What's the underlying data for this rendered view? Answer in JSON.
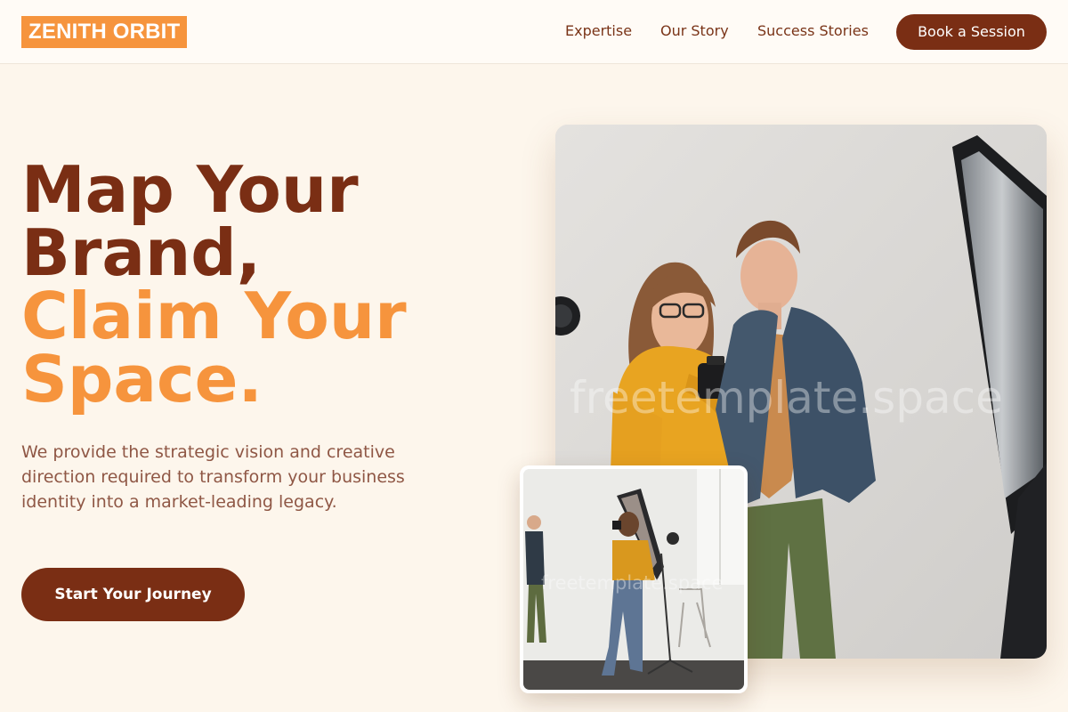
{
  "brand": {
    "logo_text": "ZENITH ORBIT"
  },
  "nav": {
    "items": [
      {
        "label": "Expertise"
      },
      {
        "label": "Our Story"
      },
      {
        "label": "Success Stories"
      }
    ],
    "cta_label": "Book a Session"
  },
  "hero": {
    "headline_line1": "Map Your",
    "headline_line2": "Brand,",
    "headline_line3": "Claim Your",
    "headline_line4": "Space.",
    "description": "We provide the strategic vision and creative direction required to transform your business identity into a market-leading legacy.",
    "cta_label": "Start Your Journey"
  },
  "images": {
    "main_watermark": "freetemplate.space",
    "inset_watermark": "freetemplate.space"
  },
  "colors": {
    "brand_dark": "#7a2e14",
    "brand_accent": "#f6943d",
    "page_background": "#fdf6ec"
  },
  "icons": [
    "camera-icon",
    "softbox-icon"
  ]
}
